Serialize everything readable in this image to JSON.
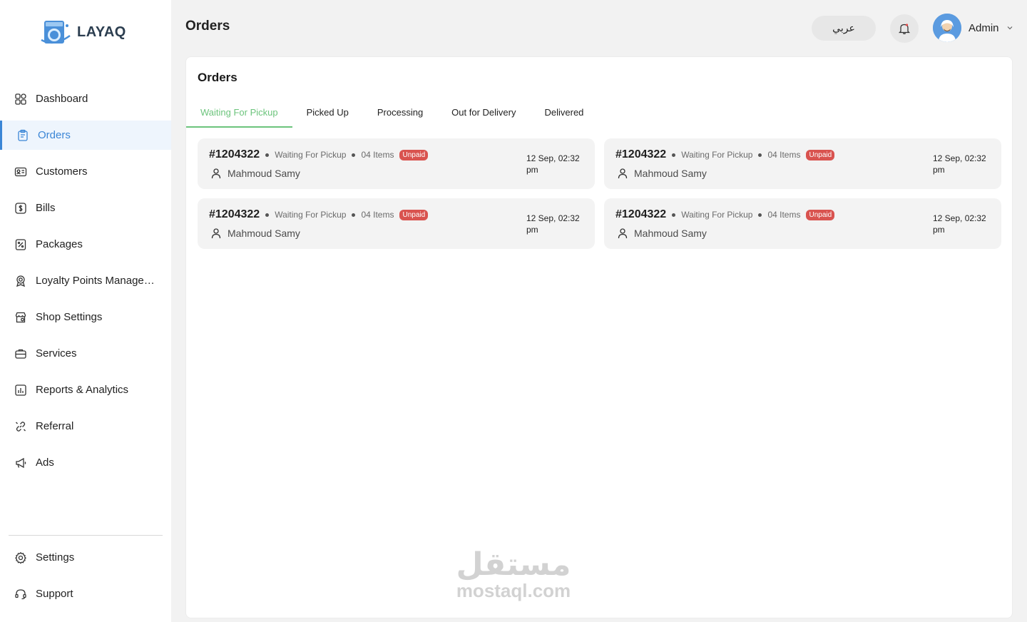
{
  "brand": {
    "name": "LAYAQ",
    "accent": "#3b86d6"
  },
  "sidebar": {
    "items": [
      {
        "label": "Dashboard",
        "icon": "grid-icon",
        "active": false
      },
      {
        "label": "Orders",
        "icon": "clipboard-icon",
        "active": true
      },
      {
        "label": "Customers",
        "icon": "id-card-icon",
        "active": false
      },
      {
        "label": "Bills",
        "icon": "dollar-icon",
        "active": false
      },
      {
        "label": "Packages",
        "icon": "package-icon",
        "active": false
      },
      {
        "label": "Loyalty Points Manage…",
        "icon": "award-icon",
        "active": false
      },
      {
        "label": "Shop Settings",
        "icon": "shop-icon",
        "active": false
      },
      {
        "label": "Services",
        "icon": "briefcase-icon",
        "active": false
      },
      {
        "label": "Reports & Analytics",
        "icon": "chart-icon",
        "active": false
      },
      {
        "label": "Referral",
        "icon": "link-icon",
        "active": false
      },
      {
        "label": "Ads",
        "icon": "megaphone-icon",
        "active": false
      }
    ],
    "bottom_items": [
      {
        "label": "Settings",
        "icon": "gear-icon"
      },
      {
        "label": "Support",
        "icon": "headset-icon"
      }
    ]
  },
  "header": {
    "title": "Orders",
    "language_button": "عربي",
    "user_name": "Admin"
  },
  "panel": {
    "title": "Orders",
    "tabs": [
      {
        "label": "Waiting For Pickup",
        "active": true
      },
      {
        "label": "Picked Up",
        "active": false
      },
      {
        "label": "Processing",
        "active": false
      },
      {
        "label": "Out for Delivery",
        "active": false
      },
      {
        "label": "Delivered",
        "active": false
      }
    ],
    "orders": [
      {
        "number": "#1204322",
        "status": "Waiting For Pickup",
        "items": "04 Items",
        "payment": "Unpaid",
        "customer": "Mahmoud Samy",
        "date": "12 Sep, 02:32 pm"
      },
      {
        "number": "#1204322",
        "status": "Waiting For Pickup",
        "items": "04 Items",
        "payment": "Unpaid",
        "customer": "Mahmoud Samy",
        "date": "12 Sep, 02:32 pm"
      },
      {
        "number": "#1204322",
        "status": "Waiting For Pickup",
        "items": "04 Items",
        "payment": "Unpaid",
        "customer": "Mahmoud Samy",
        "date": "12 Sep, 02:32 pm"
      },
      {
        "number": "#1204322",
        "status": "Waiting For Pickup",
        "items": "04 Items",
        "payment": "Unpaid",
        "customer": "Mahmoud Samy",
        "date": "12 Sep, 02:32 pm"
      }
    ]
  },
  "watermark": {
    "arabic": "مستقل",
    "latin": "mostaql.com"
  }
}
